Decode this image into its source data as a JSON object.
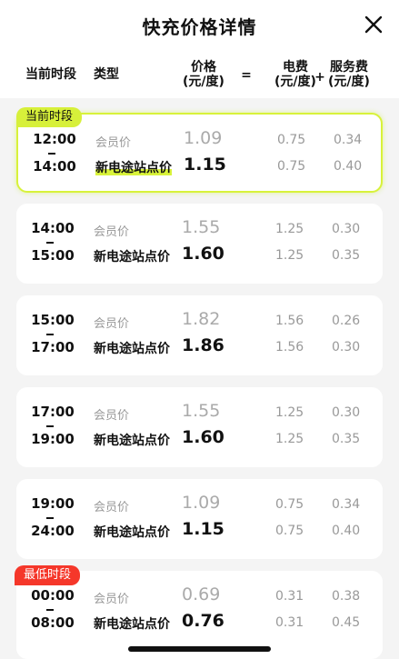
{
  "header": {
    "title": "快充价格详情",
    "col_time": "当前时段",
    "col_type": "类型",
    "col_price": "价格",
    "col_price_unit": "(元/度)",
    "equals": "=",
    "col_elec": "电费",
    "col_elec_unit": "(元/度)",
    "plus": "+",
    "col_service": "服务费",
    "col_service_unit": "(元/度)"
  },
  "rows": [
    {
      "badge": "当前时段",
      "start": "12:00",
      "end": "14:00",
      "member_label": "会员价",
      "member_price": "1.09",
      "member_elec": "0.75",
      "member_service": "0.34",
      "normal_label": "新电途站点价",
      "normal_price": "1.15",
      "normal_elec": "0.75",
      "normal_service": "0.40"
    },
    {
      "start": "14:00",
      "end": "15:00",
      "member_label": "会员价",
      "member_price": "1.55",
      "member_elec": "1.25",
      "member_service": "0.30",
      "normal_label": "新电途站点价",
      "normal_price": "1.60",
      "normal_elec": "1.25",
      "normal_service": "0.35"
    },
    {
      "start": "15:00",
      "end": "17:00",
      "member_label": "会员价",
      "member_price": "1.82",
      "member_elec": "1.56",
      "member_service": "0.26",
      "normal_label": "新电途站点价",
      "normal_price": "1.86",
      "normal_elec": "1.56",
      "normal_service": "0.30"
    },
    {
      "start": "17:00",
      "end": "19:00",
      "member_label": "会员价",
      "member_price": "1.55",
      "member_elec": "1.25",
      "member_service": "0.30",
      "normal_label": "新电途站点价",
      "normal_price": "1.60",
      "normal_elec": "1.25",
      "normal_service": "0.35"
    },
    {
      "start": "19:00",
      "end": "24:00",
      "member_label": "会员价",
      "member_price": "1.09",
      "member_elec": "0.75",
      "member_service": "0.34",
      "normal_label": "新电途站点价",
      "normal_price": "1.15",
      "normal_elec": "0.75",
      "normal_service": "0.40"
    },
    {
      "badge": "最低时段",
      "start": "00:00",
      "end": "08:00",
      "member_label": "会员价",
      "member_price": "0.69",
      "member_elec": "0.31",
      "member_service": "0.38",
      "normal_label": "新电途站点价",
      "normal_price": "0.76",
      "normal_elec": "0.31",
      "normal_service": "0.45"
    }
  ],
  "colors": {
    "current_accent": "#d7f03a",
    "lowest_accent": "#f5372a",
    "background": "#f4f4f4"
  },
  "icons": {
    "close": "close-icon"
  }
}
